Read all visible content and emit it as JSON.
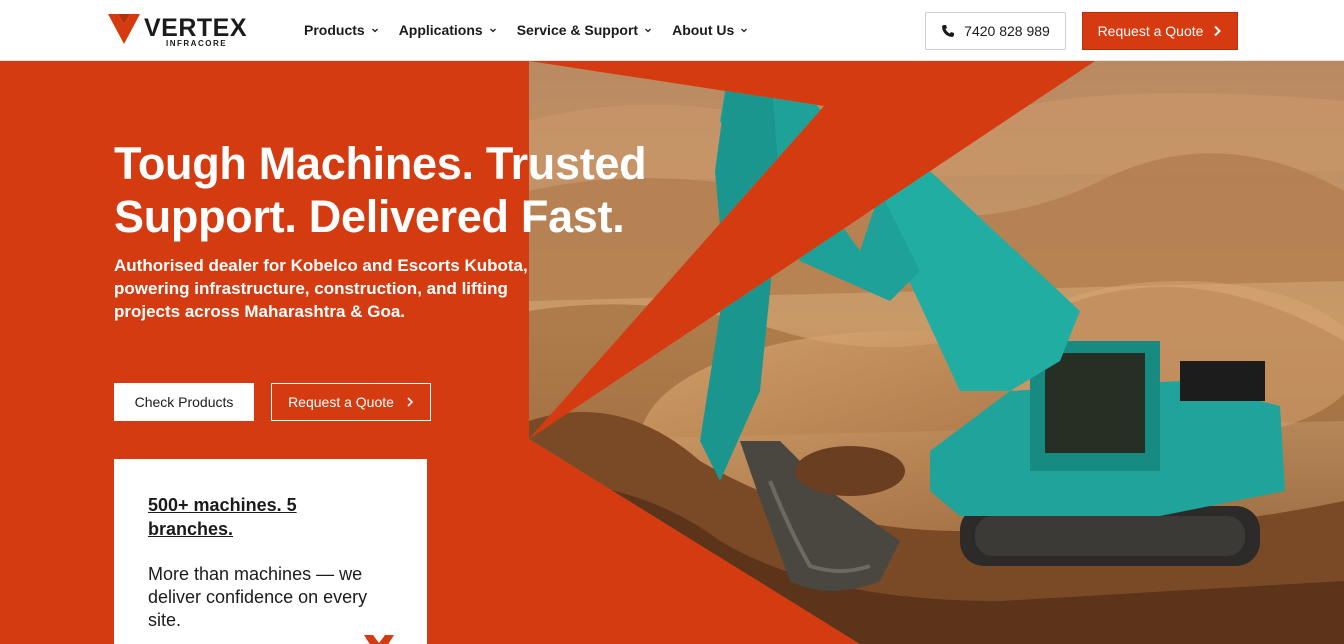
{
  "brand": {
    "name": "VERTEX",
    "tagline": "INFRACORE",
    "accent_color": "#d63a10"
  },
  "nav": {
    "items": [
      {
        "label": "Products"
      },
      {
        "label": "Applications"
      },
      {
        "label": "Service & Support"
      },
      {
        "label": "About Us"
      }
    ]
  },
  "header": {
    "phone": "7420 828 989",
    "quote_label": "Request a Quote"
  },
  "hero": {
    "headline": "Tough Machines. Trusted Support. Delivered Fast.",
    "subline": "Authorised dealer for Kobelco and Escorts Kubota, powering infrastructure, construction, and lifting projects across Maharashtra & Goa.",
    "check_label": "Check Products",
    "quote_label": "Request a Quote",
    "background_color": "#d53b10"
  },
  "stats_card": {
    "title": "500+ machines. 5 branches.",
    "text": "More than machines — we deliver confidence on every site."
  },
  "icons": [
    "chevron-down-icon",
    "phone-icon",
    "chevron-right-icon"
  ]
}
